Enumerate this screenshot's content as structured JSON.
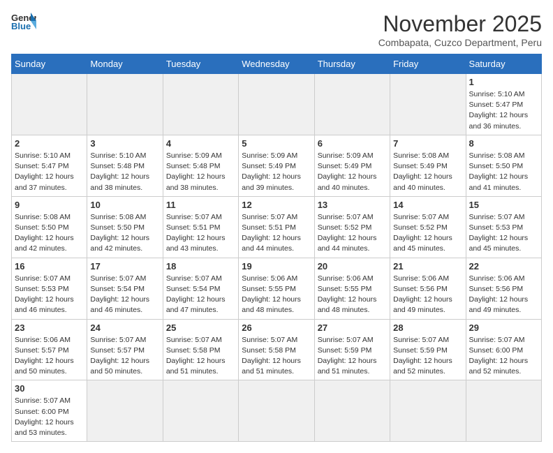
{
  "logo": {
    "text_general": "General",
    "text_blue": "Blue"
  },
  "header": {
    "month_title": "November 2025",
    "subtitle": "Combapata, Cuzco Department, Peru"
  },
  "weekdays": [
    "Sunday",
    "Monday",
    "Tuesday",
    "Wednesday",
    "Thursday",
    "Friday",
    "Saturday"
  ],
  "weeks": [
    [
      {
        "day": "",
        "empty": true
      },
      {
        "day": "",
        "empty": true
      },
      {
        "day": "",
        "empty": true
      },
      {
        "day": "",
        "empty": true
      },
      {
        "day": "",
        "empty": true
      },
      {
        "day": "",
        "empty": true
      },
      {
        "day": "1",
        "info": "Sunrise: 5:10 AM\nSunset: 5:47 PM\nDaylight: 12 hours\nand 36 minutes."
      }
    ],
    [
      {
        "day": "2",
        "info": "Sunrise: 5:10 AM\nSunset: 5:47 PM\nDaylight: 12 hours\nand 37 minutes."
      },
      {
        "day": "3",
        "info": "Sunrise: 5:10 AM\nSunset: 5:48 PM\nDaylight: 12 hours\nand 38 minutes."
      },
      {
        "day": "4",
        "info": "Sunrise: 5:09 AM\nSunset: 5:48 PM\nDaylight: 12 hours\nand 38 minutes."
      },
      {
        "day": "5",
        "info": "Sunrise: 5:09 AM\nSunset: 5:49 PM\nDaylight: 12 hours\nand 39 minutes."
      },
      {
        "day": "6",
        "info": "Sunrise: 5:09 AM\nSunset: 5:49 PM\nDaylight: 12 hours\nand 40 minutes."
      },
      {
        "day": "7",
        "info": "Sunrise: 5:08 AM\nSunset: 5:49 PM\nDaylight: 12 hours\nand 40 minutes."
      },
      {
        "day": "8",
        "info": "Sunrise: 5:08 AM\nSunset: 5:50 PM\nDaylight: 12 hours\nand 41 minutes."
      }
    ],
    [
      {
        "day": "9",
        "info": "Sunrise: 5:08 AM\nSunset: 5:50 PM\nDaylight: 12 hours\nand 42 minutes."
      },
      {
        "day": "10",
        "info": "Sunrise: 5:08 AM\nSunset: 5:50 PM\nDaylight: 12 hours\nand 42 minutes."
      },
      {
        "day": "11",
        "info": "Sunrise: 5:07 AM\nSunset: 5:51 PM\nDaylight: 12 hours\nand 43 minutes."
      },
      {
        "day": "12",
        "info": "Sunrise: 5:07 AM\nSunset: 5:51 PM\nDaylight: 12 hours\nand 44 minutes."
      },
      {
        "day": "13",
        "info": "Sunrise: 5:07 AM\nSunset: 5:52 PM\nDaylight: 12 hours\nand 44 minutes."
      },
      {
        "day": "14",
        "info": "Sunrise: 5:07 AM\nSunset: 5:52 PM\nDaylight: 12 hours\nand 45 minutes."
      },
      {
        "day": "15",
        "info": "Sunrise: 5:07 AM\nSunset: 5:53 PM\nDaylight: 12 hours\nand 45 minutes."
      }
    ],
    [
      {
        "day": "16",
        "info": "Sunrise: 5:07 AM\nSunset: 5:53 PM\nDaylight: 12 hours\nand 46 minutes."
      },
      {
        "day": "17",
        "info": "Sunrise: 5:07 AM\nSunset: 5:54 PM\nDaylight: 12 hours\nand 46 minutes."
      },
      {
        "day": "18",
        "info": "Sunrise: 5:07 AM\nSunset: 5:54 PM\nDaylight: 12 hours\nand 47 minutes."
      },
      {
        "day": "19",
        "info": "Sunrise: 5:06 AM\nSunset: 5:55 PM\nDaylight: 12 hours\nand 48 minutes."
      },
      {
        "day": "20",
        "info": "Sunrise: 5:06 AM\nSunset: 5:55 PM\nDaylight: 12 hours\nand 48 minutes."
      },
      {
        "day": "21",
        "info": "Sunrise: 5:06 AM\nSunset: 5:56 PM\nDaylight: 12 hours\nand 49 minutes."
      },
      {
        "day": "22",
        "info": "Sunrise: 5:06 AM\nSunset: 5:56 PM\nDaylight: 12 hours\nand 49 minutes."
      }
    ],
    [
      {
        "day": "23",
        "info": "Sunrise: 5:06 AM\nSunset: 5:57 PM\nDaylight: 12 hours\nand 50 minutes."
      },
      {
        "day": "24",
        "info": "Sunrise: 5:07 AM\nSunset: 5:57 PM\nDaylight: 12 hours\nand 50 minutes."
      },
      {
        "day": "25",
        "info": "Sunrise: 5:07 AM\nSunset: 5:58 PM\nDaylight: 12 hours\nand 51 minutes."
      },
      {
        "day": "26",
        "info": "Sunrise: 5:07 AM\nSunset: 5:58 PM\nDaylight: 12 hours\nand 51 minutes."
      },
      {
        "day": "27",
        "info": "Sunrise: 5:07 AM\nSunset: 5:59 PM\nDaylight: 12 hours\nand 51 minutes."
      },
      {
        "day": "28",
        "info": "Sunrise: 5:07 AM\nSunset: 5:59 PM\nDaylight: 12 hours\nand 52 minutes."
      },
      {
        "day": "29",
        "info": "Sunrise: 5:07 AM\nSunset: 6:00 PM\nDaylight: 12 hours\nand 52 minutes."
      }
    ],
    [
      {
        "day": "30",
        "info": "Sunrise: 5:07 AM\nSunset: 6:00 PM\nDaylight: 12 hours\nand 53 minutes.",
        "last_row": true
      },
      {
        "day": "",
        "empty": true,
        "last_row": true
      },
      {
        "day": "",
        "empty": true,
        "last_row": true
      },
      {
        "day": "",
        "empty": true,
        "last_row": true
      },
      {
        "day": "",
        "empty": true,
        "last_row": true
      },
      {
        "day": "",
        "empty": true,
        "last_row": true
      },
      {
        "day": "",
        "empty": true,
        "last_row": true
      }
    ]
  ]
}
